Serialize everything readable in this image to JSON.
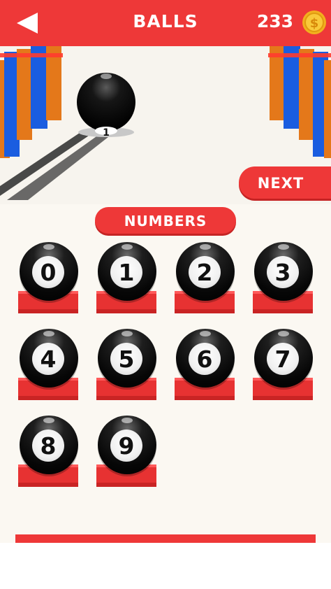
{
  "header": {
    "title": "BALLS",
    "coins": "233",
    "back_icon": "back-arrow-icon",
    "coin_icon": "gold-coin-icon"
  },
  "preview": {
    "ball_number": "1"
  },
  "next_label": "NEXT",
  "category": "NUMBERS",
  "balls": [
    "0",
    "1",
    "2",
    "3",
    "4",
    "5",
    "6",
    "7",
    "8",
    "9"
  ],
  "colors": {
    "accent": "#ee3838",
    "background": "#fbf8f2",
    "ball": "#0a0a0a"
  }
}
